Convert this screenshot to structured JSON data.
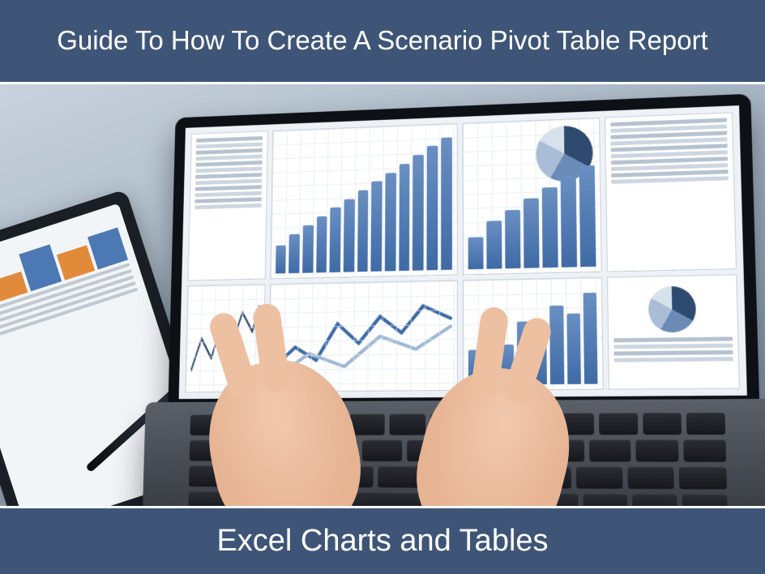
{
  "header": {
    "title": "Guide To How To Create A Scenario Pivot Table Report"
  },
  "footer": {
    "caption": "Excel Charts and Tables"
  },
  "colors": {
    "banner_bg": "#3e5577",
    "banner_fg": "#ffffff",
    "accent_blue": "#3e6aa5"
  },
  "image": {
    "description": "Photograph-style illustration of hands typing on a laptop whose screen shows a dashboard of Excel-style charts, tables, bar graphs, line charts and pie charts. A tablet with a bar chart and a pen rest on the desk to the left."
  }
}
